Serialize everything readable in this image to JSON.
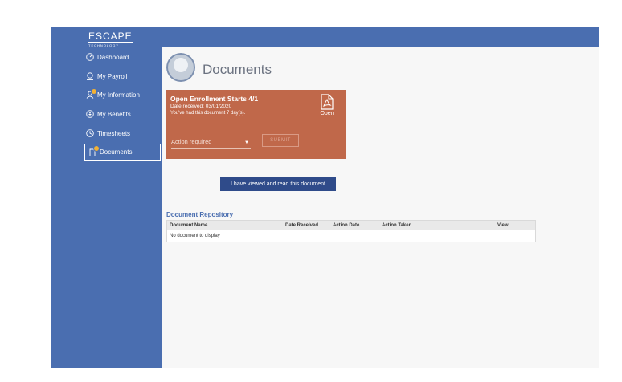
{
  "brand": {
    "logo_main": "ESCAPE",
    "logo_sub": "TECHNOLOGY"
  },
  "sidebar": {
    "items": [
      {
        "label": "Dashboard",
        "icon": "dashboard-icon"
      },
      {
        "label": "My Payroll",
        "icon": "payroll-icon"
      },
      {
        "label": "My Information",
        "icon": "person-icon"
      },
      {
        "label": "My Benefits",
        "icon": "benefits-icon"
      },
      {
        "label": "Timesheets",
        "icon": "clock-icon"
      },
      {
        "label": "Documents",
        "icon": "document-icon",
        "active": true
      }
    ]
  },
  "page": {
    "title": "Documents"
  },
  "card": {
    "title": "Open Enrollment Starts 4/1",
    "date_received": "Date received: 03/01/2020",
    "had_doc": "You've had this document 7 day(s).",
    "open_label": "Open",
    "action_placeholder": "Action required",
    "submit_label": "SUBMIT",
    "color": "#c0684a"
  },
  "tooltip": {
    "text": "I have viewed and read this document"
  },
  "repository": {
    "title": "Document Repository",
    "columns": [
      "Document Name",
      "Date Received",
      "Action Date",
      "Action Taken",
      "View"
    ],
    "empty_text": "No document to display"
  },
  "colors": {
    "nav": "#4a6eb0",
    "accent": "#4a6eb0"
  }
}
